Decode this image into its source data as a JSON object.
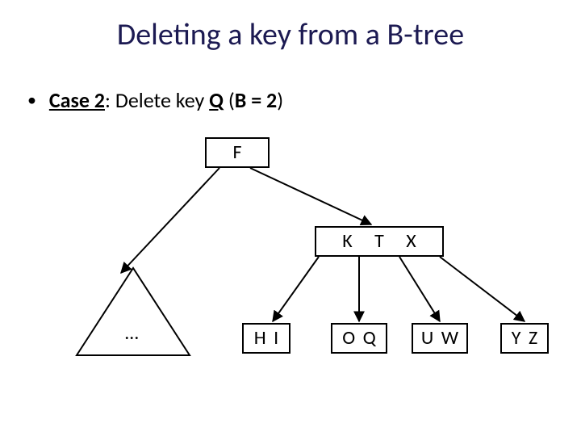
{
  "title": "Deleting a key from a B-tree",
  "bullet": {
    "case_label": "Case 2",
    "colon": ": ",
    "action": "Delete key ",
    "key": "Q",
    "space": "  (",
    "param": "B = 2",
    "close": ")"
  },
  "tree": {
    "root": {
      "keys": [
        "F"
      ]
    },
    "left_subtree_label": "…",
    "internal": {
      "keys": [
        "K",
        "T",
        "X"
      ]
    },
    "leaves": [
      {
        "keys": [
          "H",
          "I"
        ]
      },
      {
        "keys": [
          "O",
          "Q"
        ]
      },
      {
        "keys": [
          "U",
          "W"
        ]
      },
      {
        "keys": [
          "Y",
          "Z"
        ]
      }
    ]
  }
}
